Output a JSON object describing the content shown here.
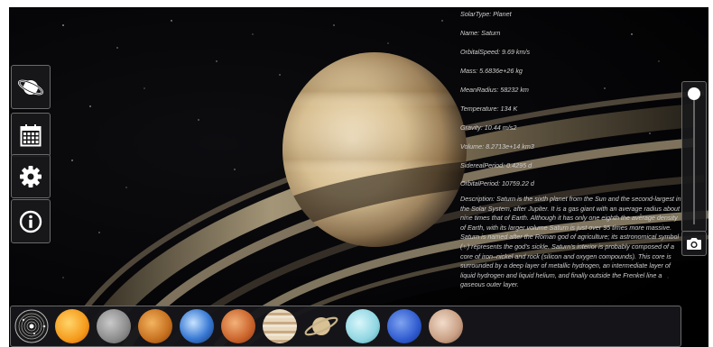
{
  "info": {
    "solar_type": "SolarType: Planet",
    "name": "Name: Saturn",
    "orbital_speed": "OrbitalSpeed: 9.69 km/s",
    "mass": "Mass: 5.6836e+26 kg",
    "mean_radius": "MeanRadius: 58232 km",
    "temperature": "Temperature: 134 K",
    "gravity": "Gravity: 10.44 m/s2",
    "volume": "Volume: 8.2713e+14 km3",
    "sidereal_period": "SiderealPeriod: 0.4295 d",
    "orbital_period": "OrbitalPeriod: 10759.22 d",
    "description": "Description: Saturn is the sixth planet from the Sun and the second-largest in the Solar System, after Jupiter. It is a gas giant with an average radius about nine times that of Earth. Although it has only one eighth the average density of Earth, with its larger volume Saturn is just over 95 times more massive. Saturn is named after the Roman god of agriculture; its astronomical symbol (♄) represents the god's sickle. Saturn's interior is probably composed of a core of iron–nickel and rock (silicon and oxygen compounds). This core is surrounded by a deep layer of metallic hydrogen, an intermediate layer of liquid hydrogen and liquid helium, and finally outside the Frenkel line a gaseous outer layer."
  },
  "side_menu": [
    "planet-icon",
    "calendar-icon",
    "gear-icon",
    "info-icon"
  ],
  "zoom": {
    "level": 0.0
  },
  "planet_bar": [
    "solar-system-icon",
    "sun",
    "mercury",
    "venus",
    "earth",
    "mars",
    "jupiter",
    "saturn",
    "uranus",
    "neptune",
    "pluto"
  ],
  "colors": {
    "panel_bg": "#19191c",
    "panel_border": "#6a6a6a",
    "info_text": "#cfcfcf"
  }
}
